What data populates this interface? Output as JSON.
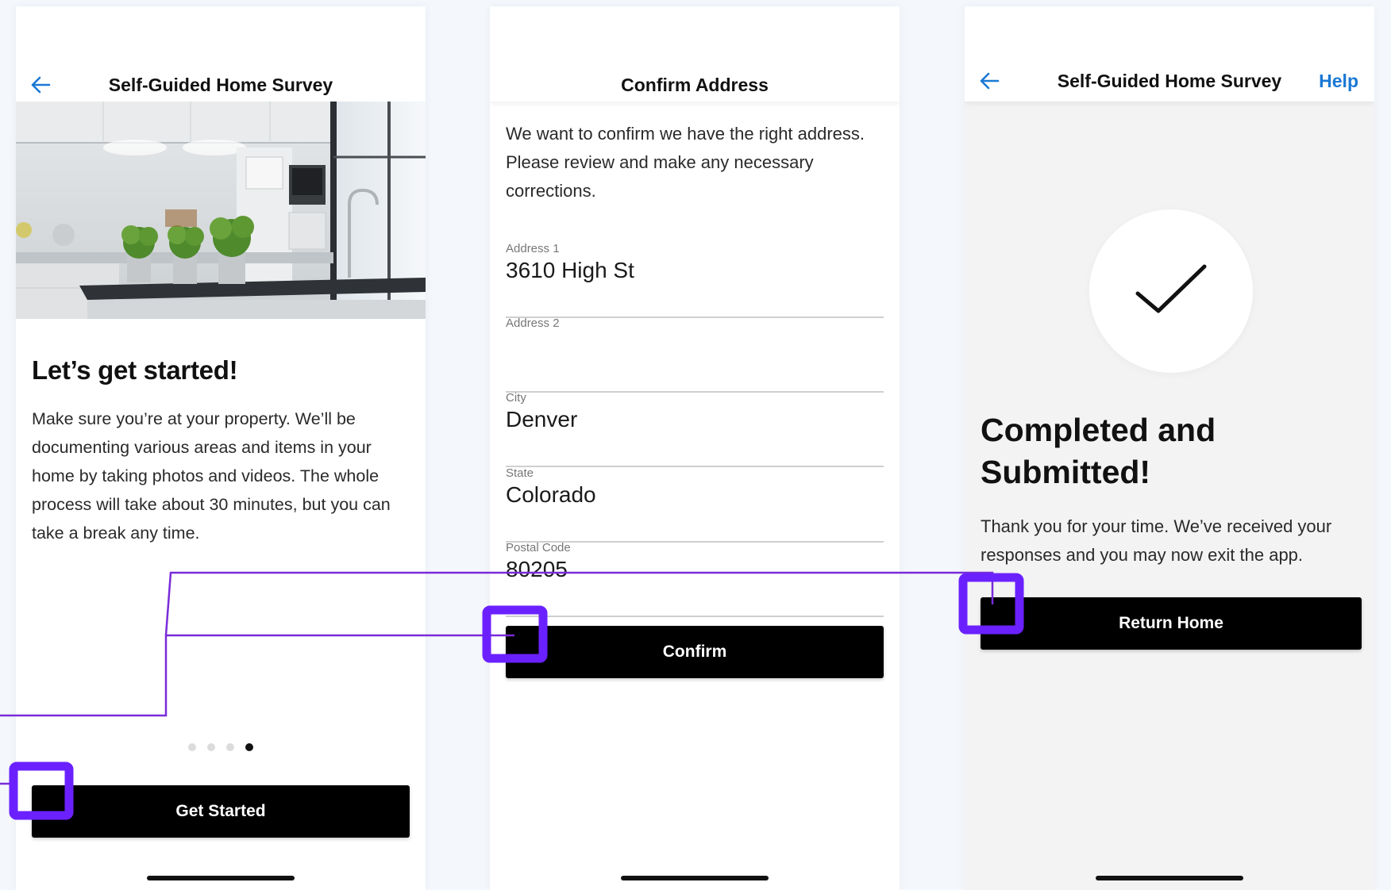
{
  "colors": {
    "accent_blue": "#1a78d4",
    "button_black": "#000000",
    "annotation_purple": "#6b21ff",
    "annotation_line": "#7a2bd9"
  },
  "screen1": {
    "nav_title": "Self-Guided Home Survey",
    "back_icon": "arrow-left-icon",
    "heading": "Let’s get started!",
    "body": "Make sure you’re at your property. We’ll be documenting various areas and items in your home by taking photos and videos. The whole process will take about 30 minutes, but you can take a break any time.",
    "pagination": {
      "count": 4,
      "active_index": 3
    },
    "button_label": "Get Started"
  },
  "screen2": {
    "nav_title": "Confirm Address",
    "intro": "We want to confirm we have the right address. Please review and make any necessary corrections.",
    "fields": [
      {
        "label": "Address 1",
        "value": "3610 High St"
      },
      {
        "label": "Address 2",
        "value": ""
      },
      {
        "label": "City",
        "value": "Denver"
      },
      {
        "label": "State",
        "value": "Colorado"
      },
      {
        "label": "Postal Code",
        "value": "80205"
      }
    ],
    "button_label": "Confirm"
  },
  "screen3": {
    "nav_title": "Self-Guided Home Survey",
    "back_icon": "arrow-left-icon",
    "help_label": "Help",
    "check_icon": "checkmark-icon",
    "heading": "Completed and Submitted!",
    "body": "Thank you for your time. We’ve received your responses and you may now exit the app.",
    "button_label": "Return Home"
  }
}
